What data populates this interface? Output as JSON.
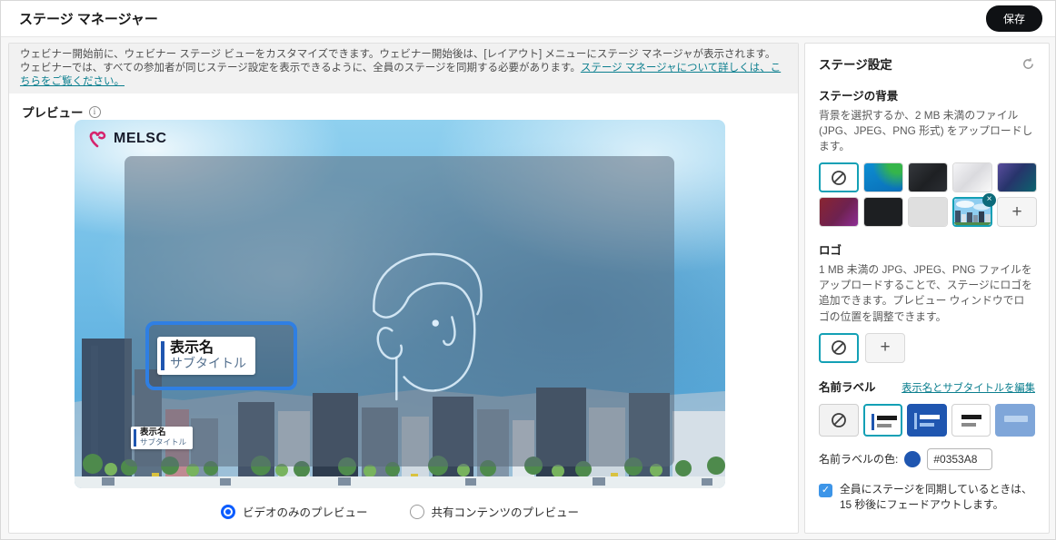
{
  "header": {
    "title": "ステージ マネージャー",
    "save_label": "保存"
  },
  "banner": {
    "line1": "ウェビナー開始前に、ウェビナー ステージ ビューをカスタマイズできます。ウェビナー開始後は、[レイアウト] メニューにステージ マネージャが表示されます。",
    "line2": "ウェビナーでは、すべての参加者が同じステージ設定を表示できるように、全員のステージを同期する必要があります。",
    "link": "ステージ マネージャについて詳しくは、こちらをご覧ください。"
  },
  "preview": {
    "title": "プレビュー",
    "brand": "MELSC",
    "label_display_name": "表示名",
    "label_subtitle": "サブタイトル",
    "radio_video": "ビデオのみのプレビュー",
    "radio_shared": "共有コンテンツのプレビュー"
  },
  "settings": {
    "title": "ステージ設定",
    "background_title": "ステージの背景",
    "background_description": "背景を選択するか、2 MB 未満のファイル (JPG、JPEG、PNG 形式) をアップロードします。",
    "logo_title": "ロゴ",
    "logo_description": "1 MB 未満の JPG、JPEG、PNG ファイルをアップロードすることで、ステージにロゴを追加できます。プレビュー ウィンドウでロゴの位置を調整できます。",
    "name_label_title": "名前ラベル",
    "edit_link": "表示名とサブタイトルを編集",
    "color_label": "名前ラベルの色:",
    "color_value": "#0353A8",
    "sync_text": "全員にステージを同期しているときは、15 秒後にフェードアウトします。"
  },
  "icons": {
    "plus": "+",
    "close": "×",
    "check": "✓",
    "info": "i"
  },
  "colors": {
    "accent_teal": "#13a0b5",
    "link_teal": "#0c7f8f",
    "name_label_blue": "#0353A8",
    "selection_blue": "#2f7fe3",
    "save_button_black": "#0f1114",
    "checkbox_blue": "#3d95e8"
  }
}
